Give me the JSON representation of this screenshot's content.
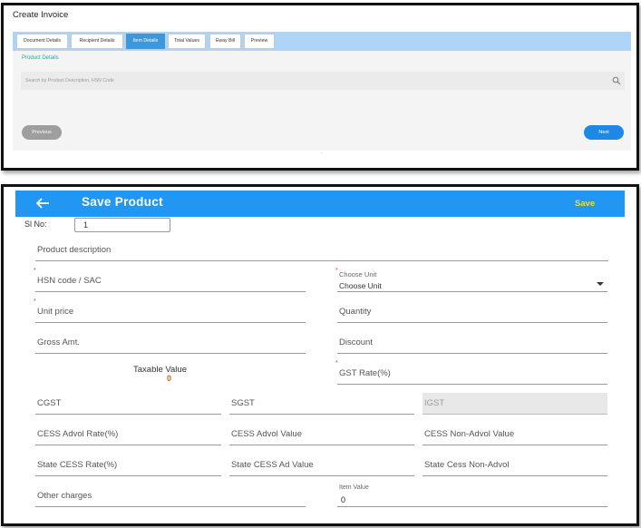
{
  "invoice": {
    "title": "Create Invoice",
    "tabs": [
      {
        "label": "Document Details"
      },
      {
        "label": "Recipient Details"
      },
      {
        "label": "Item Details"
      },
      {
        "label": "Total Values"
      },
      {
        "label": "Eway Bill"
      },
      {
        "label": "Preview"
      }
    ],
    "active_tab": "Item Details",
    "section_title": "Product Details",
    "search_placeholder": "Search by Product Description, HSN Code",
    "prev_label": "Previous",
    "next_label": "Next",
    "colors": {
      "tabbar": "#aed4f7",
      "active_tab": "#3d97d8",
      "next": "#1e88e5",
      "section": "#26a79a"
    }
  },
  "product": {
    "title": "Save Product",
    "save_label": "Save",
    "sl_label": "Sl No:",
    "sl_value": "1",
    "fields": {
      "product_description": "Product description",
      "hsn": "HSN code / SAC",
      "choose_unit_label": "Choose Unit",
      "choose_unit_value": "Choose Unit",
      "unit_price": "Unit price",
      "quantity": "Quantity",
      "gross_amt": "Gross Amt.",
      "discount": "Discount",
      "taxable_label": "Taxable Value",
      "taxable_value": "0",
      "gst_rate": "GST Rate(%)",
      "cgst": "CGST",
      "sgst": "SGST",
      "igst": "IGST",
      "cess_advol_rate": "CESS Advol Rate(%)",
      "cess_advol_value": "CESS Advol Value",
      "cess_non_advol_value": "CESS Non-Advol Value",
      "state_cess_rate": "State CESS Rate(%)",
      "state_cess_ad_value": "State CESS Ad Value",
      "state_cess_non_advol": "State Cess Non-Advol",
      "other_charges": "Other charges",
      "item_value_label": "Item Value",
      "item_value": "0"
    },
    "required_mark": "*",
    "colors": {
      "appbar": "#2196f3",
      "save": "#f0e020",
      "required": "#e53935",
      "taxable_value": "#e06020"
    }
  }
}
